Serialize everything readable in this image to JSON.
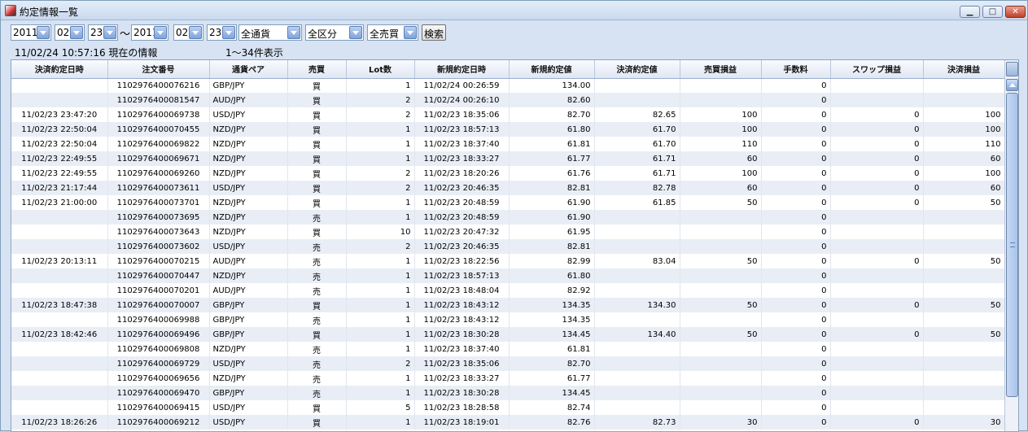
{
  "window": {
    "title": "約定情報一覧",
    "min_label": "▁",
    "max_label": "□",
    "close_label": "✕"
  },
  "toolbar": {
    "from_year": "2011",
    "from_month": "02",
    "from_day": "23",
    "separator": "〜",
    "to_year": "2011",
    "to_month": "02",
    "to_day": "23",
    "currency": "全通貨",
    "category": "全区分",
    "side": "全売買",
    "search_label": "検索"
  },
  "info": {
    "timestamp": "11/02/24 10:57:16 現在の情報",
    "count": "1〜34件表示"
  },
  "table": {
    "headers": [
      "決済約定日時",
      "注文番号",
      "通貨ペア",
      "売買",
      "Lot数",
      "新規約定日時",
      "新規約定値",
      "決済約定値",
      "売買損益",
      "手数料",
      "スワップ損益",
      "決済損益"
    ],
    "rows": [
      [
        "",
        "1102976400076216",
        "GBP/JPY",
        "買",
        "1",
        "11/02/24 00:26:59",
        "134.00",
        "",
        "",
        "0",
        "",
        ""
      ],
      [
        "",
        "1102976400081547",
        "AUD/JPY",
        "買",
        "2",
        "11/02/24 00:26:10",
        "82.60",
        "",
        "",
        "0",
        "",
        ""
      ],
      [
        "11/02/23 23:47:20",
        "1102976400069738",
        "USD/JPY",
        "買",
        "2",
        "11/02/23 18:35:06",
        "82.70",
        "82.65",
        "100",
        "0",
        "0",
        "100"
      ],
      [
        "11/02/23 22:50:04",
        "1102976400070455",
        "NZD/JPY",
        "買",
        "1",
        "11/02/23 18:57:13",
        "61.80",
        "61.70",
        "100",
        "0",
        "0",
        "100"
      ],
      [
        "11/02/23 22:50:04",
        "1102976400069822",
        "NZD/JPY",
        "買",
        "1",
        "11/02/23 18:37:40",
        "61.81",
        "61.70",
        "110",
        "0",
        "0",
        "110"
      ],
      [
        "11/02/23 22:49:55",
        "1102976400069671",
        "NZD/JPY",
        "買",
        "1",
        "11/02/23 18:33:27",
        "61.77",
        "61.71",
        "60",
        "0",
        "0",
        "60"
      ],
      [
        "11/02/23 22:49:55",
        "1102976400069260",
        "NZD/JPY",
        "買",
        "2",
        "11/02/23 18:20:26",
        "61.76",
        "61.71",
        "100",
        "0",
        "0",
        "100"
      ],
      [
        "11/02/23 21:17:44",
        "1102976400073611",
        "USD/JPY",
        "買",
        "2",
        "11/02/23 20:46:35",
        "82.81",
        "82.78",
        "60",
        "0",
        "0",
        "60"
      ],
      [
        "11/02/23 21:00:00",
        "1102976400073701",
        "NZD/JPY",
        "買",
        "1",
        "11/02/23 20:48:59",
        "61.90",
        "61.85",
        "50",
        "0",
        "0",
        "50"
      ],
      [
        "",
        "1102976400073695",
        "NZD/JPY",
        "売",
        "1",
        "11/02/23 20:48:59",
        "61.90",
        "",
        "",
        "0",
        "",
        ""
      ],
      [
        "",
        "1102976400073643",
        "NZD/JPY",
        "買",
        "10",
        "11/02/23 20:47:32",
        "61.95",
        "",
        "",
        "0",
        "",
        ""
      ],
      [
        "",
        "1102976400073602",
        "USD/JPY",
        "売",
        "2",
        "11/02/23 20:46:35",
        "82.81",
        "",
        "",
        "0",
        "",
        ""
      ],
      [
        "11/02/23 20:13:11",
        "1102976400070215",
        "AUD/JPY",
        "売",
        "1",
        "11/02/23 18:22:56",
        "82.99",
        "83.04",
        "50",
        "0",
        "0",
        "50"
      ],
      [
        "",
        "1102976400070447",
        "NZD/JPY",
        "売",
        "1",
        "11/02/23 18:57:13",
        "61.80",
        "",
        "",
        "0",
        "",
        ""
      ],
      [
        "",
        "1102976400070201",
        "AUD/JPY",
        "売",
        "1",
        "11/02/23 18:48:04",
        "82.92",
        "",
        "",
        "0",
        "",
        ""
      ],
      [
        "11/02/23 18:47:38",
        "1102976400070007",
        "GBP/JPY",
        "買",
        "1",
        "11/02/23 18:43:12",
        "134.35",
        "134.30",
        "50",
        "0",
        "0",
        "50"
      ],
      [
        "",
        "1102976400069988",
        "GBP/JPY",
        "売",
        "1",
        "11/02/23 18:43:12",
        "134.35",
        "",
        "",
        "0",
        "",
        ""
      ],
      [
        "11/02/23 18:42:46",
        "1102976400069496",
        "GBP/JPY",
        "買",
        "1",
        "11/02/23 18:30:28",
        "134.45",
        "134.40",
        "50",
        "0",
        "0",
        "50"
      ],
      [
        "",
        "1102976400069808",
        "NZD/JPY",
        "売",
        "1",
        "11/02/23 18:37:40",
        "61.81",
        "",
        "",
        "0",
        "",
        ""
      ],
      [
        "",
        "1102976400069729",
        "USD/JPY",
        "売",
        "2",
        "11/02/23 18:35:06",
        "82.70",
        "",
        "",
        "0",
        "",
        ""
      ],
      [
        "",
        "1102976400069656",
        "NZD/JPY",
        "売",
        "1",
        "11/02/23 18:33:27",
        "61.77",
        "",
        "",
        "0",
        "",
        ""
      ],
      [
        "",
        "1102976400069470",
        "GBP/JPY",
        "売",
        "1",
        "11/02/23 18:30:28",
        "134.45",
        "",
        "",
        "0",
        "",
        ""
      ],
      [
        "",
        "1102976400069415",
        "USD/JPY",
        "買",
        "5",
        "11/02/23 18:28:58",
        "82.74",
        "",
        "",
        "0",
        "",
        ""
      ],
      [
        "11/02/23 18:26:26",
        "1102976400069212",
        "USD/JPY",
        "買",
        "1",
        "11/02/23 18:19:01",
        "82.76",
        "82.73",
        "30",
        "0",
        "0",
        "30"
      ]
    ]
  }
}
